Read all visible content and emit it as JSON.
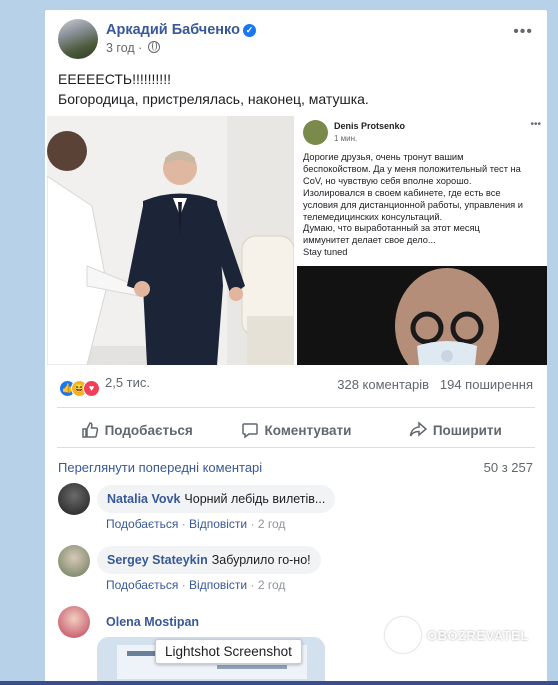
{
  "post": {
    "author": "Аркадий Бабченко",
    "time": "3 год",
    "menu": "•••",
    "text_line1": "ЕЕЕЕЕСТЬ!!!!!!!!!!",
    "text_line2": "Богородица, пристрелялась, наконец, матушка."
  },
  "screenshot": {
    "name": "Denis Protsenko",
    "time": "1 мин.",
    "lines": [
      "Дорогие друзья, очень тронут вашим",
      "беспокойством. Да у меня положительный тест на",
      "CoV, но чувствую себя вполне хорошо.",
      "Изолировался в своем кабинете, где есть все",
      "условия для дистанционной работы, управления и",
      "телемедицинских консультаций.",
      "Думаю, что выработанный за этот месяц",
      "иммунитет делает свое дело...",
      " Stay tuned"
    ]
  },
  "stats": {
    "reactions": "2,5 тис.",
    "comments": "328 коментарів",
    "shares": "194 поширення"
  },
  "actions": {
    "like": "Подобається",
    "comment": "Коментувати",
    "share": "Поширити"
  },
  "comments_section": {
    "previous": "Переглянути попередні коментарі",
    "pager": "50 з 257",
    "items": [
      {
        "name": "Natalia Vovk",
        "text": "Чорний лебідь вилетів...",
        "like": "Подобається",
        "reply": "Відповісти",
        "time": "2 год"
      },
      {
        "name": "Sergey Stateykin",
        "text": "Забурлило го-но!",
        "like": "Подобається",
        "reply": "Відповісти",
        "time": "2 год"
      },
      {
        "name": "Olena Mostipan"
      }
    ],
    "separator": "·"
  },
  "overlay": {
    "tooltip": "Lightshot Screenshot",
    "watermark": "OBOZREVATEL"
  },
  "colors": {
    "link": "#385898",
    "verified": "#1877f2",
    "like_reaction": "#1877f2",
    "haha_reaction": "#f7b125",
    "love_reaction": "#f33e58"
  },
  "icons": {
    "verified": "✓",
    "like": "👍",
    "haha": "😆",
    "love": "♥"
  }
}
